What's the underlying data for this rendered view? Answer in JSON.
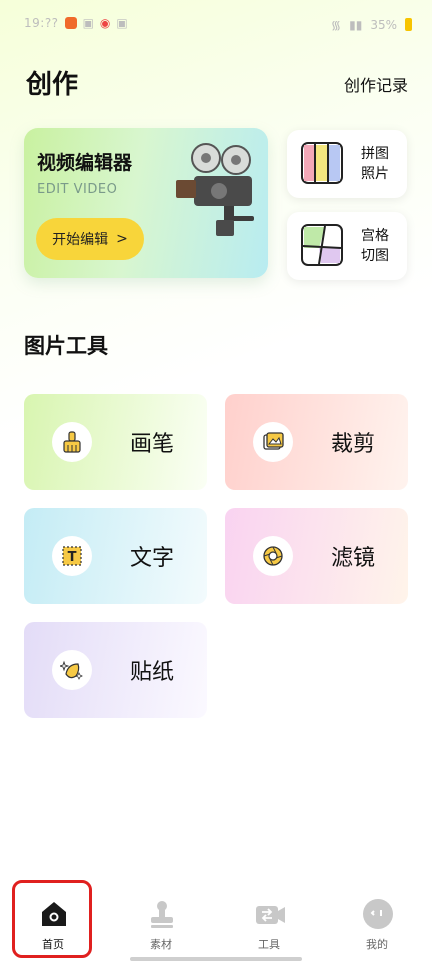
{
  "status_bar": {
    "time": "19:??",
    "right_text": "35%"
  },
  "header": {
    "title": "创作",
    "records_link": "创作记录"
  },
  "editor_card": {
    "title": "视频编辑器",
    "subtitle": "EDIT VIDEO",
    "button_label": "开始编辑",
    "button_chevron": ">"
  },
  "mini_cards": [
    {
      "label": "拼图照片",
      "icon": "collage-icon"
    },
    {
      "label": "宫格切图",
      "icon": "grid-cut-icon"
    }
  ],
  "section": {
    "title": "图片工具"
  },
  "tools": [
    {
      "label": "画笔",
      "icon": "brush-icon"
    },
    {
      "label": "裁剪",
      "icon": "crop-image-icon"
    },
    {
      "label": "文字",
      "icon": "text-icon"
    },
    {
      "label": "滤镜",
      "icon": "filter-icon"
    },
    {
      "label": "贴纸",
      "icon": "sticker-icon"
    }
  ],
  "tab_bar": {
    "items": [
      {
        "label": "首页",
        "icon": "home-icon",
        "active": true
      },
      {
        "label": "素材",
        "icon": "stamp-icon",
        "active": false
      },
      {
        "label": "工具",
        "icon": "tools-icon",
        "active": false
      },
      {
        "label": "我的",
        "icon": "profile-icon",
        "active": false
      }
    ]
  },
  "colors": {
    "accent_yellow": "#f8d53a",
    "highlight_red": "#e0201f"
  }
}
